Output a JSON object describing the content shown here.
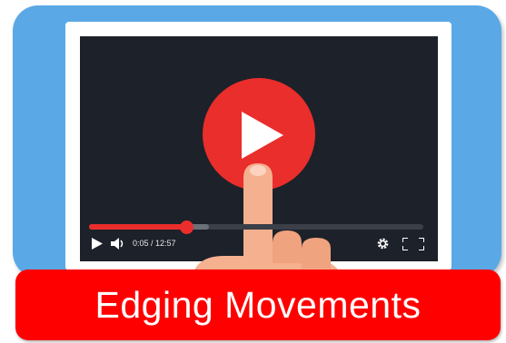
{
  "player": {
    "time_display": "0:05 / 12:57",
    "progress_fraction": 0.29,
    "buffered_fraction": 0.36
  },
  "icons": [
    "play-icon",
    "volume-icon",
    "settings-icon",
    "fullscreen-icon",
    "big-play-icon",
    "hand-pointer"
  ],
  "banner": {
    "title": "Edging Movements"
  },
  "colors": {
    "card_blue": "#5aa9e6",
    "screen_dark": "#1d2129",
    "accent_red": "#ea2e2b",
    "banner_red": "#fe0000"
  }
}
